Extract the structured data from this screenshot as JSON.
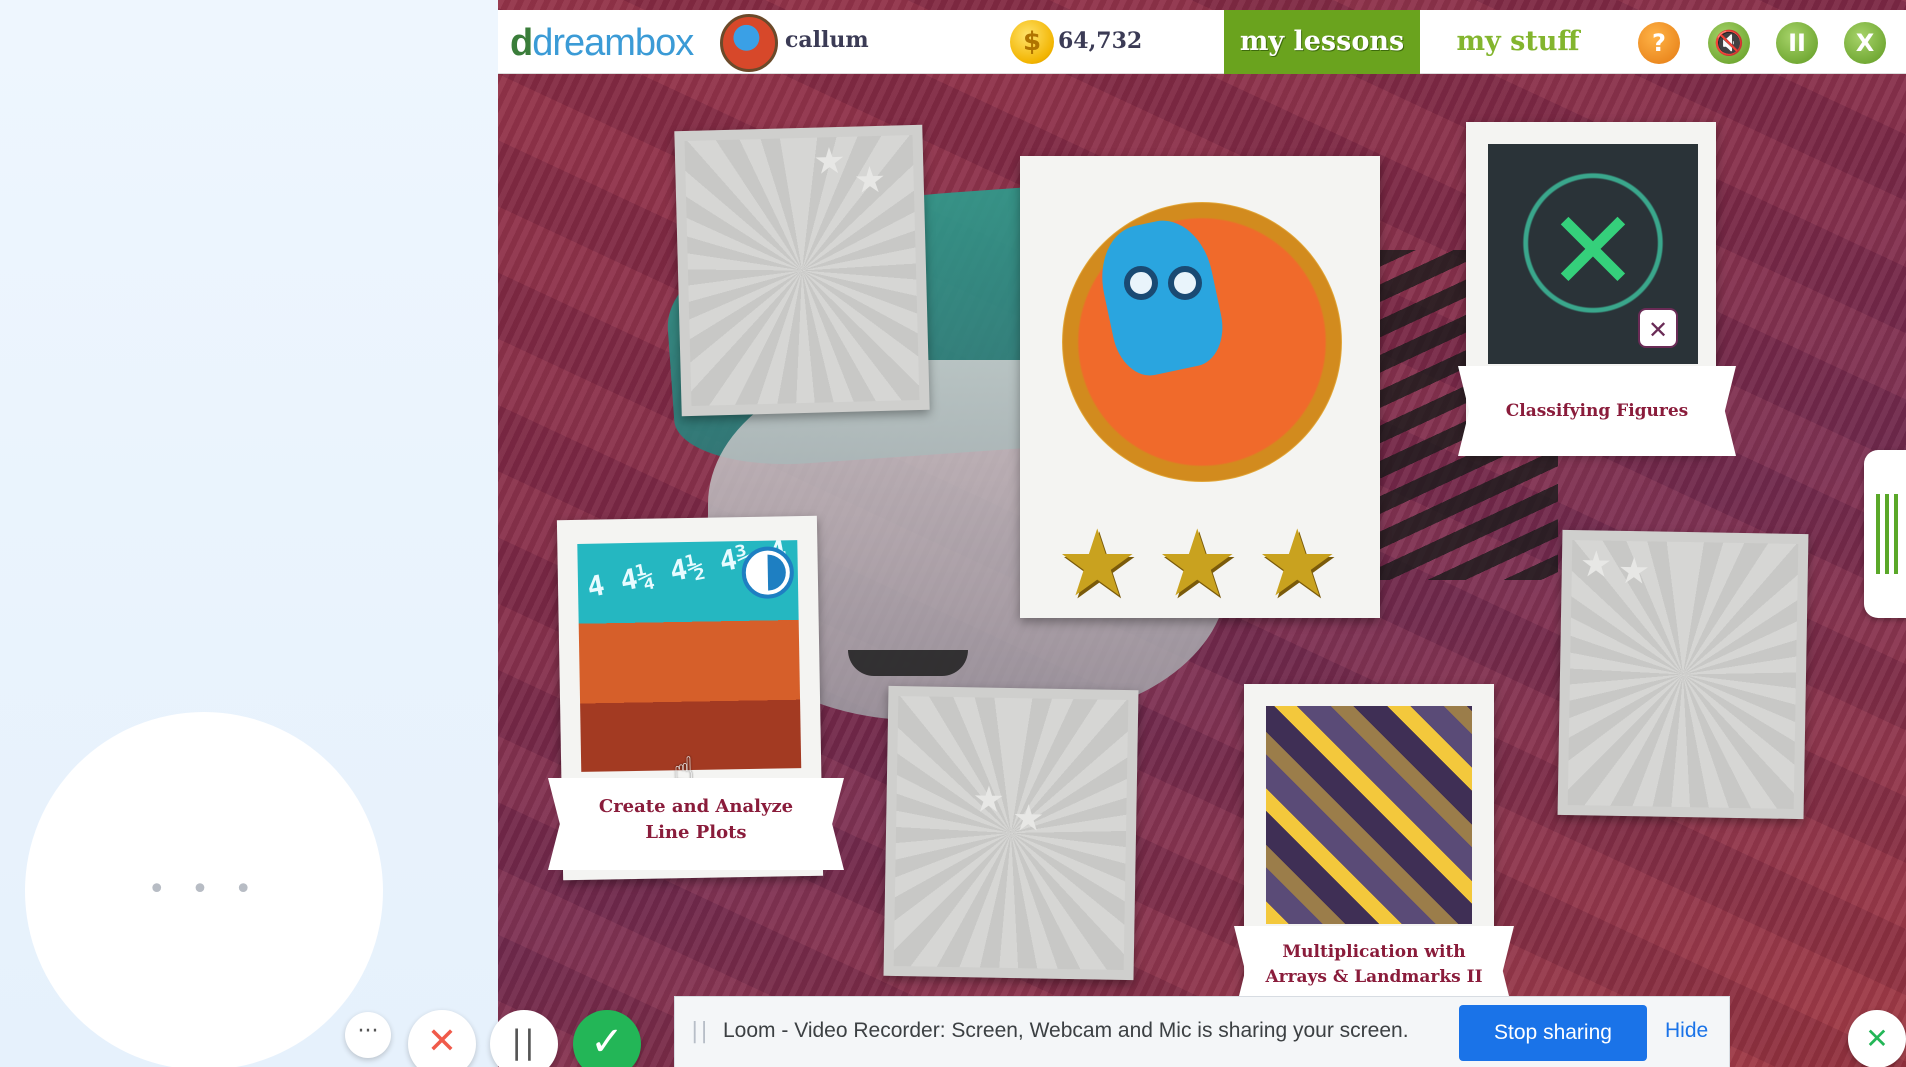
{
  "header": {
    "logo_d": "d",
    "logo_text": "dreambox",
    "username": "callum",
    "coin_symbol": "$",
    "coins": "64,732",
    "tabs": [
      {
        "label": "my lessons",
        "active": true
      },
      {
        "label": "my stuff",
        "active": false
      }
    ],
    "buttons": {
      "help": "?",
      "sound": "🔇",
      "pause": "II",
      "close": "X"
    }
  },
  "lessons": {
    "featured": {
      "stars": 3,
      "star_glyph": "★"
    },
    "classifying": {
      "title": "Classifying Figures",
      "badge": "✕"
    },
    "lineplots": {
      "title_line1": "Create and Analyze",
      "title_line2": "Line Plots",
      "ruler": "4 4¼ 4½ 4¾ 4",
      "progress": 0.5
    },
    "multiplication": {
      "title_line1": "Multiplication with",
      "title_line2": "Arrays & Landmarks II"
    },
    "locked_count": 3
  },
  "webcam": {
    "dots": "• • •"
  },
  "loom_controls": {
    "more": "···",
    "cancel": "✕",
    "pause": "||",
    "done": "✓"
  },
  "sharing_bar": {
    "grip": "||",
    "message": "Loom - Video Recorder: Screen, Webcam and Mic is sharing your screen.",
    "stop_label": "Stop sharing",
    "hide_label": "Hide"
  },
  "colors": {
    "accent_green": "#6aa31e",
    "title_maroon": "#8a1c3b",
    "stop_blue": "#1a73e8"
  }
}
